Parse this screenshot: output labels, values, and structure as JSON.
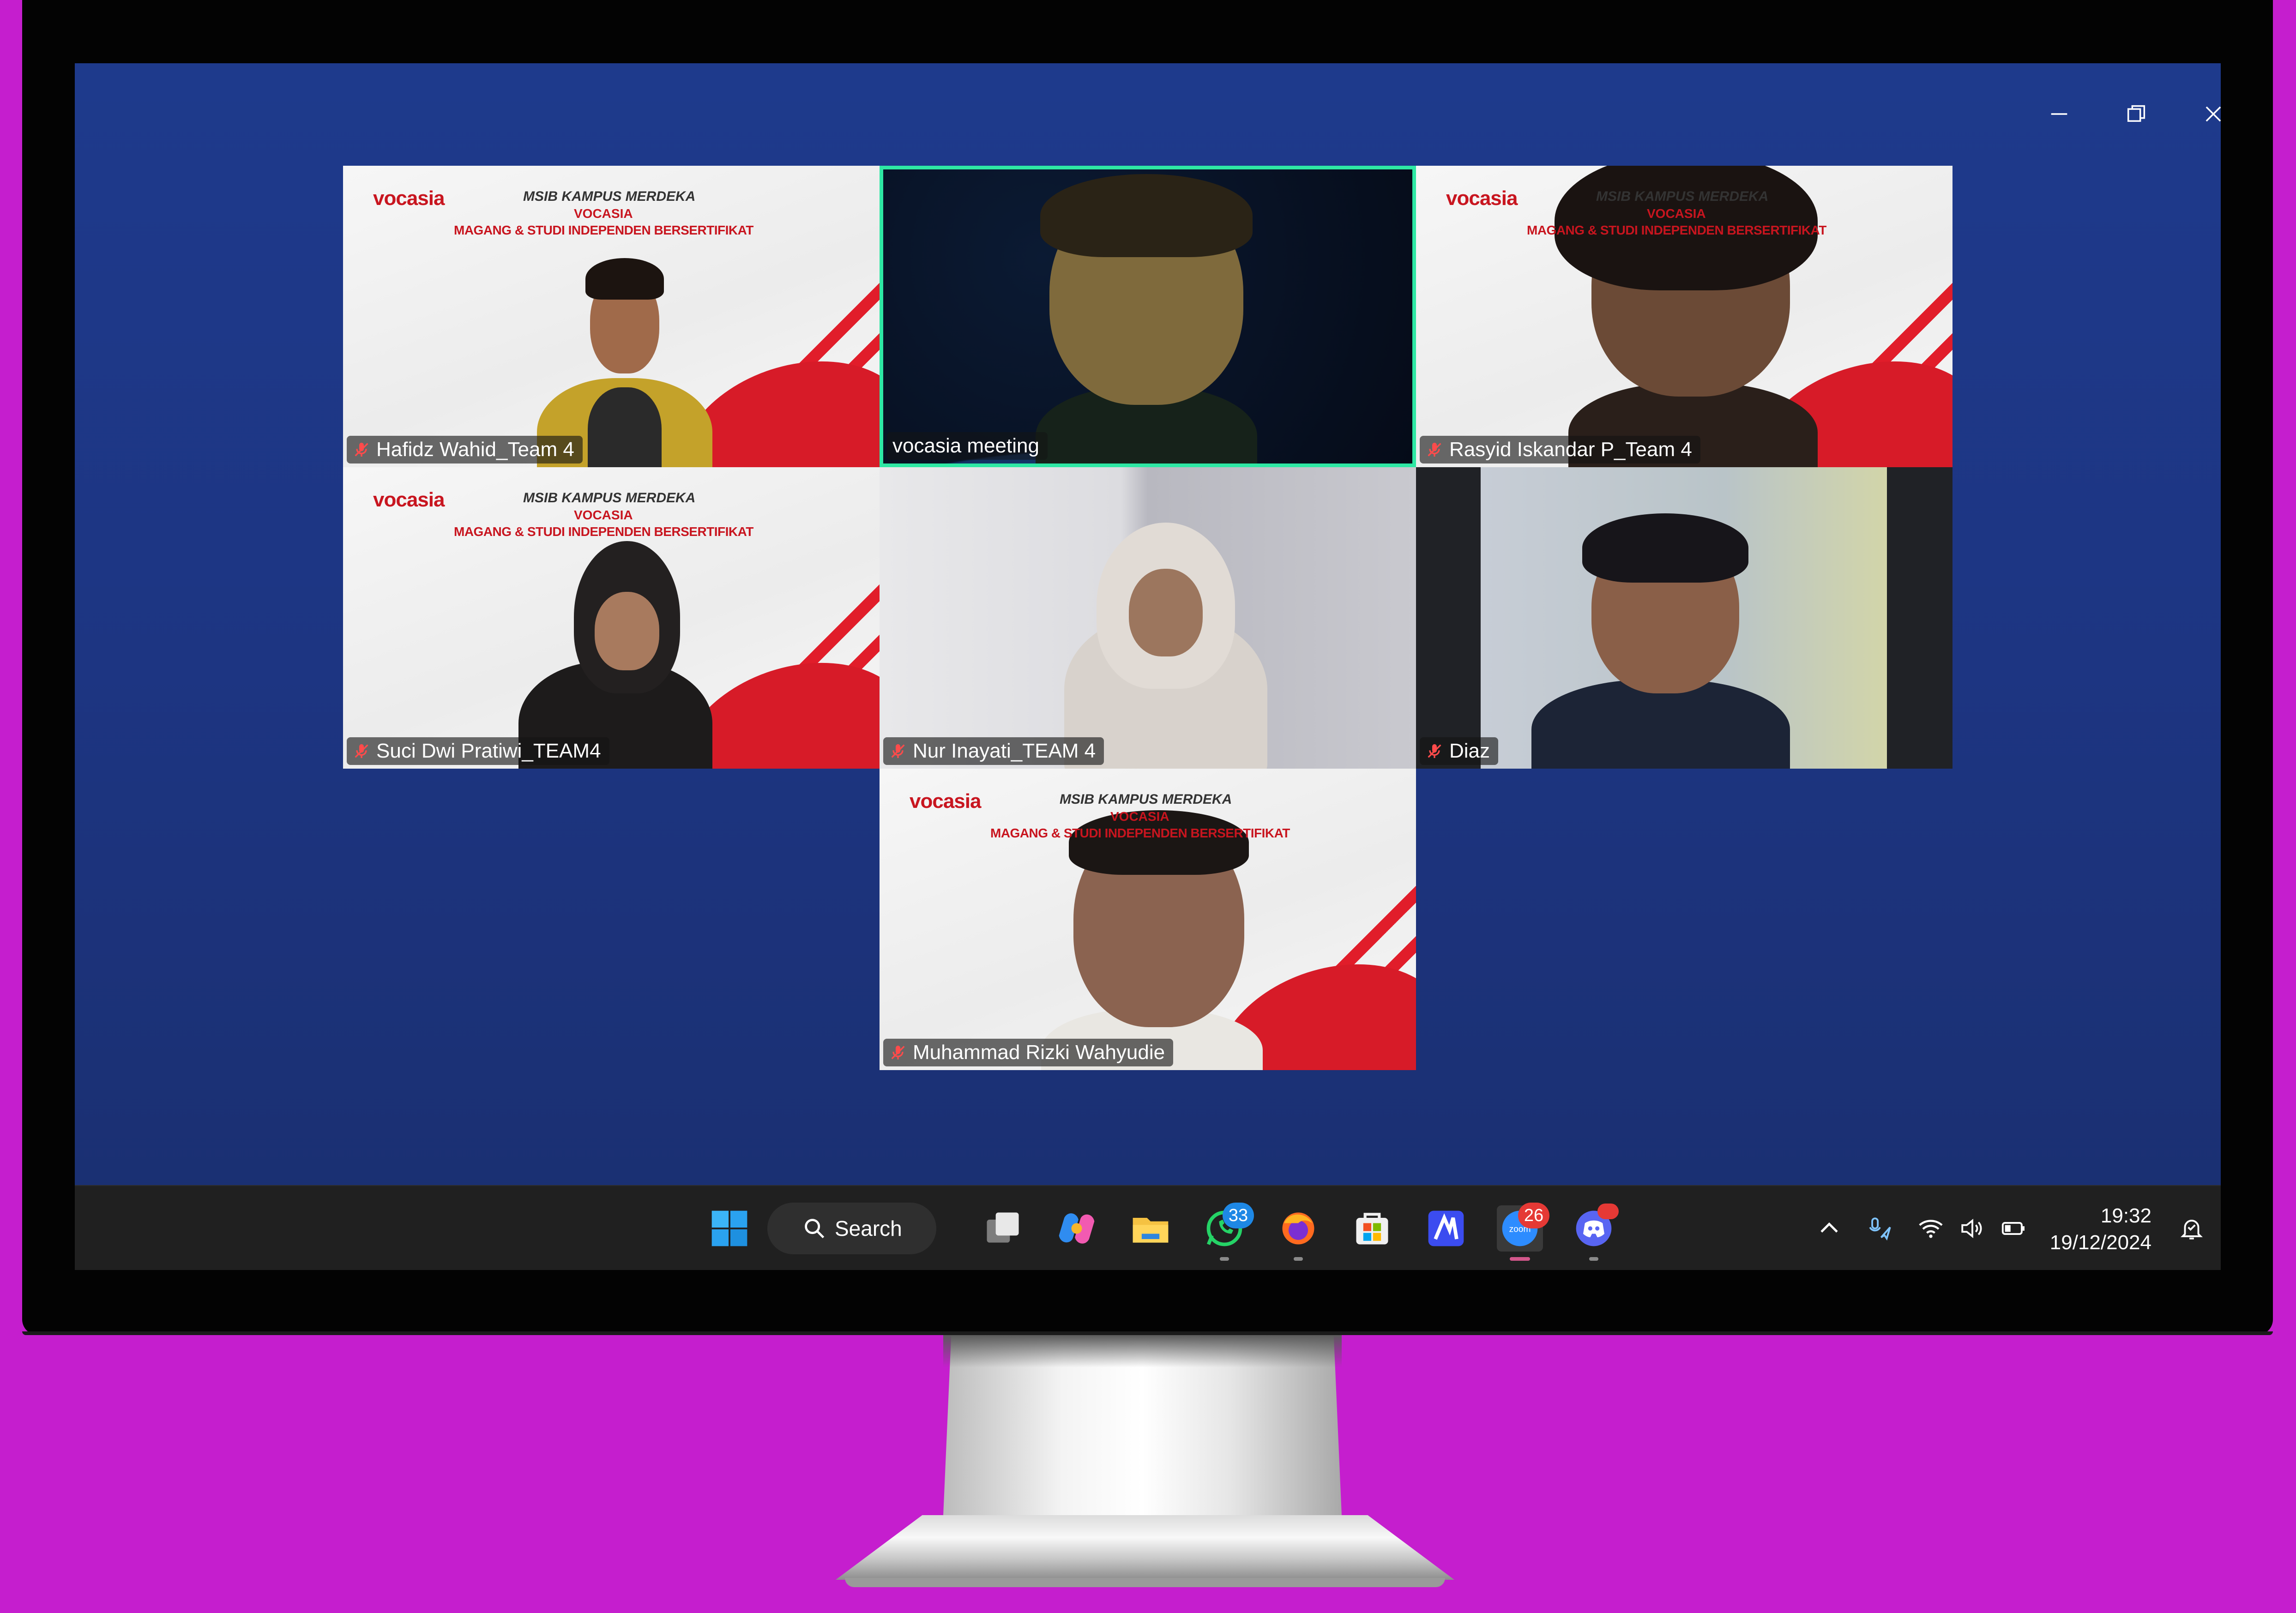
{
  "window_controls": {
    "minimize": "minimize-icon",
    "restore": "restore-icon",
    "close": "close-icon"
  },
  "banner": {
    "brand": "vocasia",
    "line1": "MSIB KAMPUS MERDEKA",
    "line2": "VOCASIA",
    "line3": "MAGANG & STUDI INDEPENDEN BERSERTIFIKAT"
  },
  "participants": [
    {
      "name": "Hafidz Wahid_Team 4",
      "muted": true,
      "background": "vocasia"
    },
    {
      "name": "vocasia meeting",
      "muted": false,
      "background": "space",
      "active_speaker": true
    },
    {
      "name": "Rasyid Iskandar P_Team 4",
      "muted": true,
      "background": "vocasia"
    },
    {
      "name": "Suci Dwi Pratiwi_TEAM4",
      "muted": true,
      "background": "vocasia"
    },
    {
      "name": "Nur Inayati_TEAM 4",
      "muted": true,
      "background": "wall"
    },
    {
      "name": "Diaz",
      "muted": true,
      "background": "room"
    },
    {
      "name": "Muhammad Rizki Wahyudie",
      "muted": true,
      "background": "vocasia"
    }
  ],
  "taskbar": {
    "search_label": "Search",
    "apps": [
      {
        "icon": "windows-start-icon"
      },
      {
        "icon": "task-view-icon"
      },
      {
        "icon": "copilot-icon"
      },
      {
        "icon": "file-explorer-icon"
      },
      {
        "icon": "whatsapp-icon",
        "badge": "33"
      },
      {
        "icon": "firefox-icon"
      },
      {
        "icon": "microsoft-store-icon"
      },
      {
        "icon": "vscode-style-icon"
      },
      {
        "icon": "zoom-icon",
        "badge": "26",
        "label": "zoom"
      },
      {
        "icon": "discord-icon"
      }
    ],
    "tray": [
      "chevron-up-icon",
      "microphone-location-icon",
      "wifi-icon",
      "speaker-icon",
      "battery-icon",
      "notification-icon"
    ],
    "time": "19:32",
    "date": "19/12/2024"
  },
  "colors": {
    "accent_active": "#2ee8a4",
    "meeting_bg": "#1e3a8c",
    "frame": "#c51ece",
    "vocasia_red": "#c8151f"
  }
}
